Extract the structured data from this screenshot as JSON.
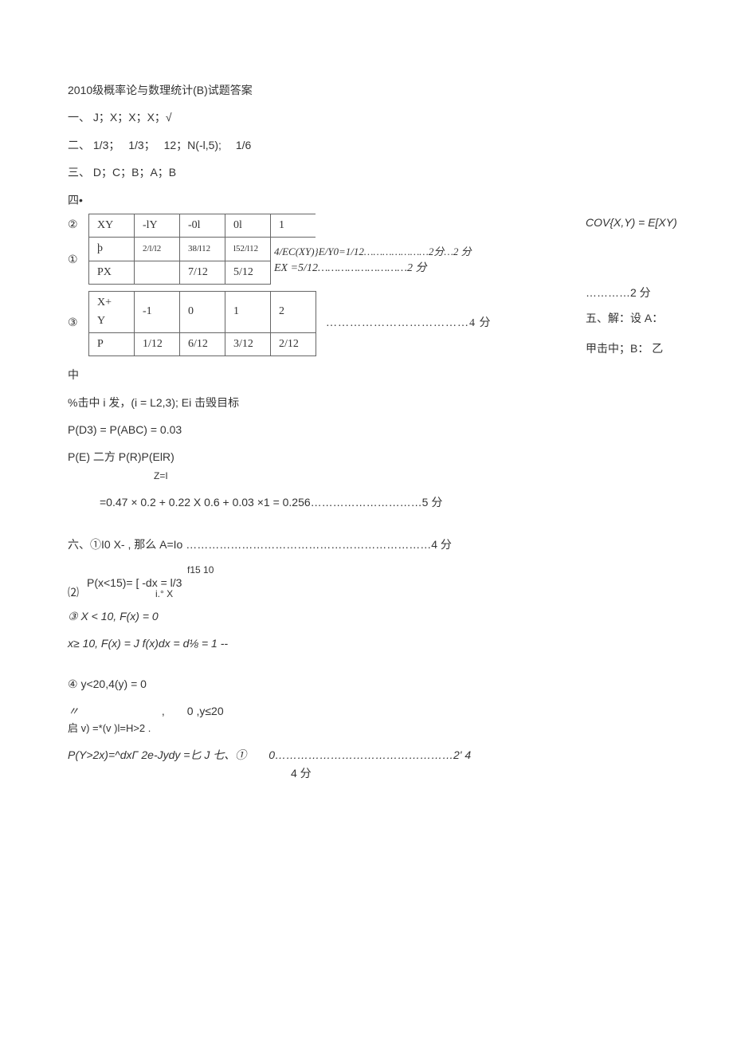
{
  "title": "2010级概率论与数理统计(B)试题答案",
  "section1": {
    "label": "一、",
    "content": "J；X；X；X；√"
  },
  "section2": {
    "label": "二、",
    "content": "1/3；　 1/3；　 12；N(-l,5);　 1/6"
  },
  "section3": {
    "label": "三、",
    "content": "D；C；B；A；B"
  },
  "section4": {
    "label": "四•",
    "num1": "②",
    "num2": "①",
    "num3": "③",
    "tableA": {
      "r1": [
        "XY",
        "-lY",
        "-0l",
        "0l",
        "1"
      ],
      "r2": [
        "þ",
        "2/l/l2",
        "38/l12",
        "l52/l12"
      ],
      "r3": [
        "PX",
        "",
        "7/12",
        "5/12"
      ]
    },
    "eqA1": "4/EC(XY)}E/Y0=1/12…………………2分…2 分",
    "eqA2": "EX =5/12………………………2 分",
    "tableB": {
      "r1": [
        "X+",
        "-1",
        "0",
        "1",
        "2"
      ],
      "r1b": [
        "Y",
        "",
        "",
        "",
        ""
      ],
      "r2": [
        "P",
        "1/12",
        "6/12",
        "3/12",
        "2/12"
      ]
    },
    "dotsB": "………………………………4 分",
    "right1": "COV{X,Y) = E[XY)",
    "right2": "…………2 分",
    "right3": "五、解：设 A：",
    "right4": "甲击中；B： 乙"
  },
  "zhong": "中",
  "line_pct": "%击中 i 发，(i = L2,3); Ei 击毁目标",
  "pd3": "P(D3) = P(ABC) = 0.03",
  "pe1": "P(E) 二方 P(R)P(ElR)",
  "pe1b": "Z=I",
  "pe2": "=0.47 × 0.2 + 0.22 X 0.6 + 0.03 ×1 = 0.256…………………………5 分",
  "six": "六、①I0 X- , 那么 A=Io  …………………………………………………………4 分",
  "px15a": "P(x<15)= [ -dx = l/3",
  "px15top": "f15 10",
  "px15bot": "i.° X",
  "px15mark": "⑵",
  "fx1": "③ X < 10, F(x) = 0",
  "fx2": "x≥ 10, F(x) = J f(x)dx = d⅛ = 1 --",
  "y20": "④ y<20,4(y) = 0",
  "dquo": "〃",
  "ycase": ",　　0 ,y≤20",
  "ycase2": "启 v) =*(v )l=H>2 .",
  "last1": "P(Y>2x)=^dxΓ 2e-Jydy =匕 J 七、①　　0…………………………………………2' 4",
  "last2": "4 分"
}
